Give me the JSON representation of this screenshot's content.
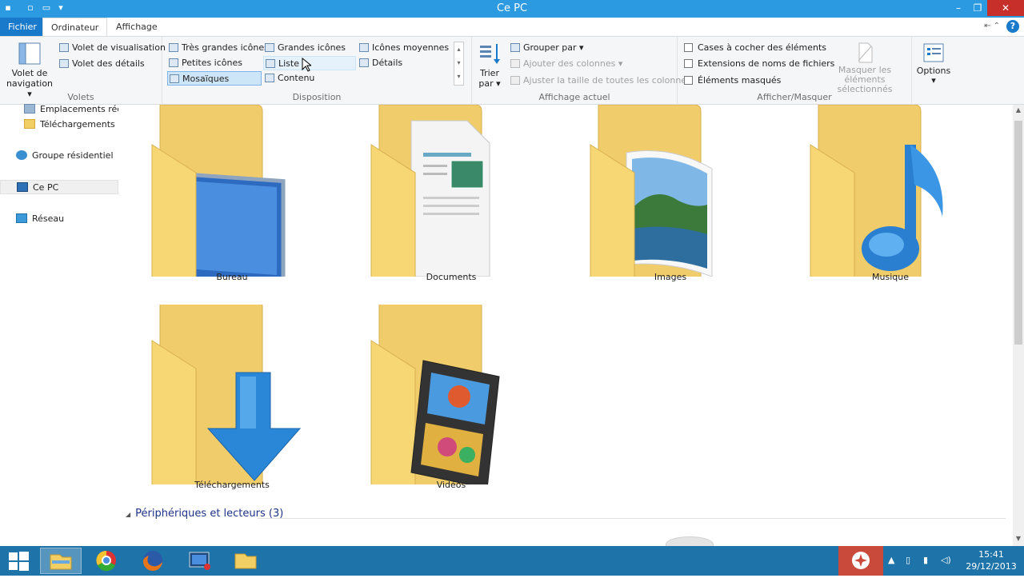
{
  "window": {
    "title": "Ce PC",
    "controls": [
      "minimize-icon",
      "restore-icon",
      "close-icon"
    ]
  },
  "tabs": {
    "file": "Fichier",
    "computer": "Ordinateur",
    "view": "Affichage"
  },
  "ribbon": {
    "panes": {
      "label": "Volets",
      "nav_pane_line1": "Volet de",
      "nav_pane_line2": "navigation",
      "preview_pane": "Volet de visualisation",
      "details_pane": "Volet des détails"
    },
    "layout": {
      "label": "Disposition",
      "extra_large": "Très grandes icônes",
      "large": "Grandes icônes",
      "medium": "Icônes moyennes",
      "small": "Petites icônes",
      "list": "Liste",
      "details": "Détails",
      "tiles": "Mosaïques",
      "content": "Contenu"
    },
    "current_view": {
      "label": "Affichage actuel",
      "sort_line1": "Trier",
      "sort_line2": "par",
      "group_by": "Grouper par",
      "add_columns": "Ajouter des colonnes",
      "size_all_columns": "Ajuster la taille de toutes les colonnes"
    },
    "show_hide": {
      "label": "Afficher/Masquer",
      "checkboxes": "Cases à cocher des éléments",
      "extensions": "Extensions de noms de fichiers",
      "hidden_items": "Éléments masqués",
      "hide_selected_line1": "Masquer les éléments",
      "hide_selected_line2": "sélectionnés"
    },
    "options": "Options"
  },
  "sidebar": {
    "items": [
      {
        "label": "Emplacements récer",
        "icon": "recent-places-icon"
      },
      {
        "label": "Téléchargements",
        "icon": "downloads-folder-icon"
      },
      {
        "label": "Groupe résidentiel",
        "icon": "homegroup-icon"
      },
      {
        "label": "Ce PC",
        "icon": "computer-icon"
      },
      {
        "label": "Réseau",
        "icon": "network-icon"
      }
    ]
  },
  "folders": [
    {
      "name": "Bureau",
      "icon": "desktop-folder-icon"
    },
    {
      "name": "Documents",
      "icon": "documents-folder-icon"
    },
    {
      "name": "Images",
      "icon": "pictures-folder-icon"
    },
    {
      "name": "Musique",
      "icon": "music-folder-icon"
    },
    {
      "name": "Téléchargements",
      "icon": "downloads-folder-icon"
    },
    {
      "name": "Vidéos",
      "icon": "videos-folder-icon"
    }
  ],
  "devices_header": "Périphériques et lecteurs (3)",
  "taskbar": {
    "apps": [
      "start-icon",
      "file-explorer-icon",
      "chrome-icon",
      "firefox-icon",
      "screen-recorder-icon",
      "folder-icon"
    ],
    "time": "15:41",
    "date": "29/12/2013"
  },
  "colors": {
    "titlebar": "#2b9ae0",
    "file_tab": "#1979ca",
    "taskbar": "#1e73a8",
    "folder_yellow": "#f6d774",
    "link_blue": "#1e3287"
  }
}
